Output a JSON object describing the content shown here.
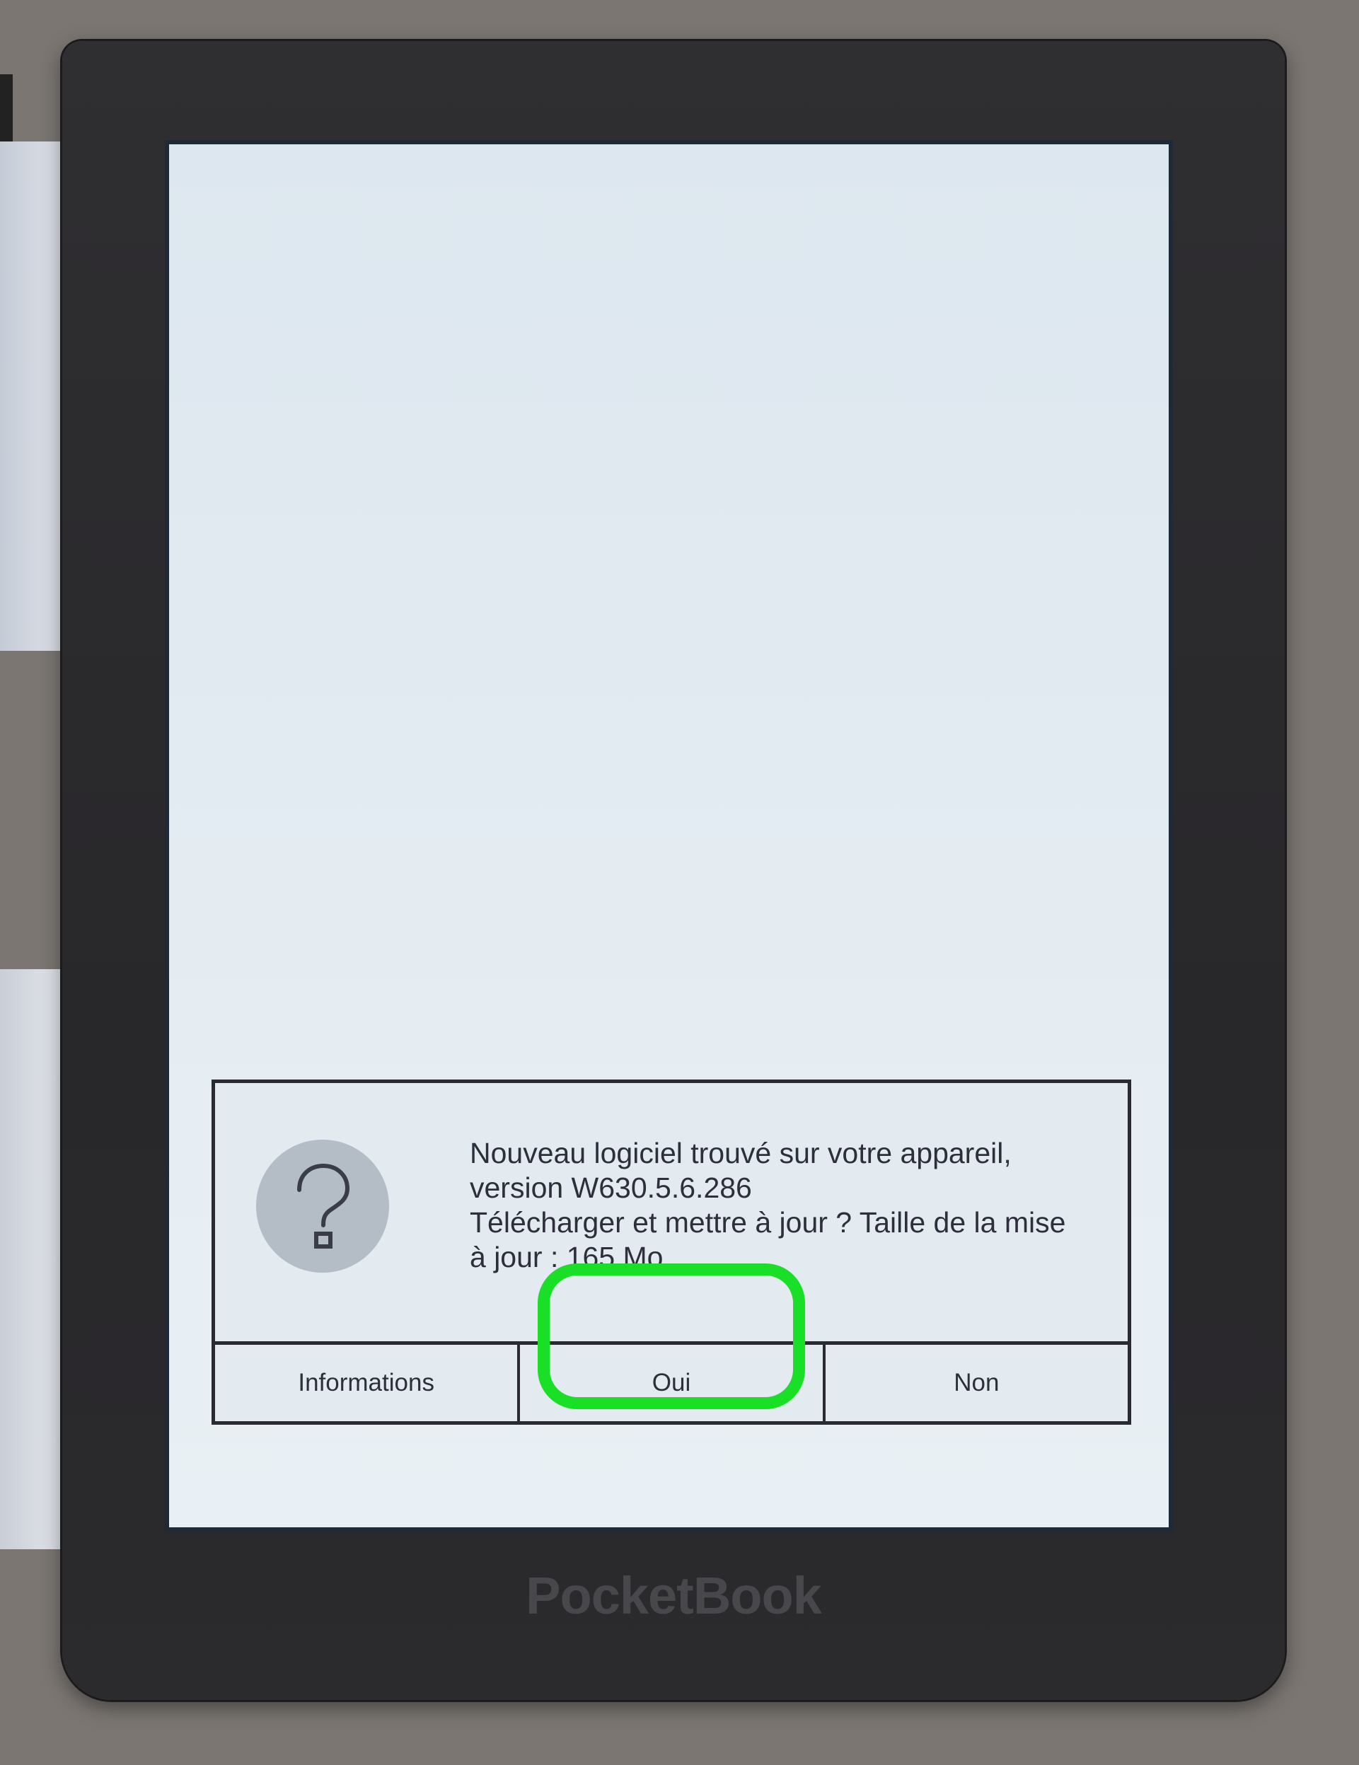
{
  "brand": "PocketBook",
  "dialog": {
    "icon": "question-mark-icon",
    "message_lines": [
      "Nouveau logiciel trouvé sur votre appareil,",
      "version W630.5.6.286",
      "Télécharger et mettre à jour ? Taille de la mise",
      "à jour : 165 Mo"
    ],
    "buttons": {
      "informations": "Informations",
      "oui": "Oui",
      "non": "Non"
    }
  },
  "colors": {
    "highlight": "#19e026",
    "screen": "#e3eaf0",
    "bezel": "#2c2b2e"
  }
}
